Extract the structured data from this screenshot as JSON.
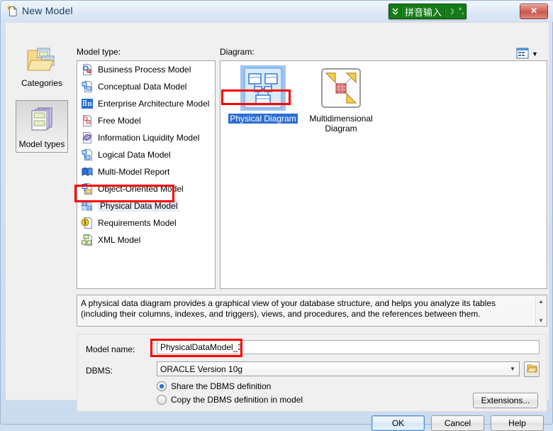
{
  "window": {
    "title": "New Model",
    "title_icon": "new-document-icon",
    "close_label": "✕"
  },
  "ime": {
    "mode_icon": "chevron-double-down-icon",
    "label": "拼音输入",
    "moon_icon": "☽",
    "punct_icon": "°,"
  },
  "sidebar": {
    "items": [
      {
        "label": "Categories",
        "icon": "folder-windows-icon",
        "selected": false
      },
      {
        "label": "Model types",
        "icon": "stacked-windows-icon",
        "selected": true
      }
    ]
  },
  "model_type": {
    "label": "Model type:",
    "items": [
      {
        "label": "Business Process Model",
        "icon": "business-process-icon",
        "selected": false
      },
      {
        "label": "Conceptual Data Model",
        "icon": "conceptual-data-icon",
        "selected": false
      },
      {
        "label": "Enterprise Architecture Model",
        "icon": "enterprise-architecture-icon",
        "selected": false
      },
      {
        "label": "Free Model",
        "icon": "free-model-icon",
        "selected": false
      },
      {
        "label": "Information Liquidity Model",
        "icon": "information-liquidity-icon",
        "selected": false
      },
      {
        "label": "Logical Data Model",
        "icon": "logical-data-icon",
        "selected": false
      },
      {
        "label": "Multi-Model Report",
        "icon": "multi-model-report-icon",
        "selected": false
      },
      {
        "label": "Object-Oriented Model",
        "icon": "object-oriented-icon",
        "selected": false
      },
      {
        "label": "Physical Data Model",
        "icon": "physical-data-icon",
        "selected": true
      },
      {
        "label": "Requirements Model",
        "icon": "requirements-icon",
        "selected": false
      },
      {
        "label": "XML Model",
        "icon": "xml-model-icon",
        "selected": false
      }
    ]
  },
  "diagram": {
    "label": "Diagram:",
    "view_mode_icon": "list-view-icon",
    "view_mode_arrow": "▼",
    "items": [
      {
        "label": "Physical Diagram",
        "icon": "physical-diagram-thumb",
        "selected": true
      },
      {
        "label": "Multidimensional Diagram",
        "icon": "multidimensional-diagram-thumb",
        "selected": false
      }
    ]
  },
  "description": {
    "text": "A physical data diagram provides a graphical view of your database structure, and helps you analyze its tables (including their columns, indexes, and triggers), views, and procedures, and the references between them.",
    "scroll_up_icon": "▲",
    "scroll_down_icon": "▼"
  },
  "form": {
    "model_name_label": "Model name:",
    "model_name_value": "PhysicalDataModel_3",
    "dbms_label": "DBMS:",
    "dbms_value": "ORACLE Version 10g",
    "dbms_arrow": "▼",
    "browse_icon": "folder-icon",
    "radio_share_label": "Share the DBMS definition",
    "radio_copy_label": "Copy the DBMS definition in model",
    "radio_selected": "share",
    "extensions_label": "Extensions..."
  },
  "footer": {
    "ok_label": "OK",
    "cancel_label": "Cancel",
    "help_label": "Help"
  },
  "colors": {
    "annotation": "#ff0000",
    "selection": "#2a6ed4",
    "ime_background": "#157a18"
  }
}
